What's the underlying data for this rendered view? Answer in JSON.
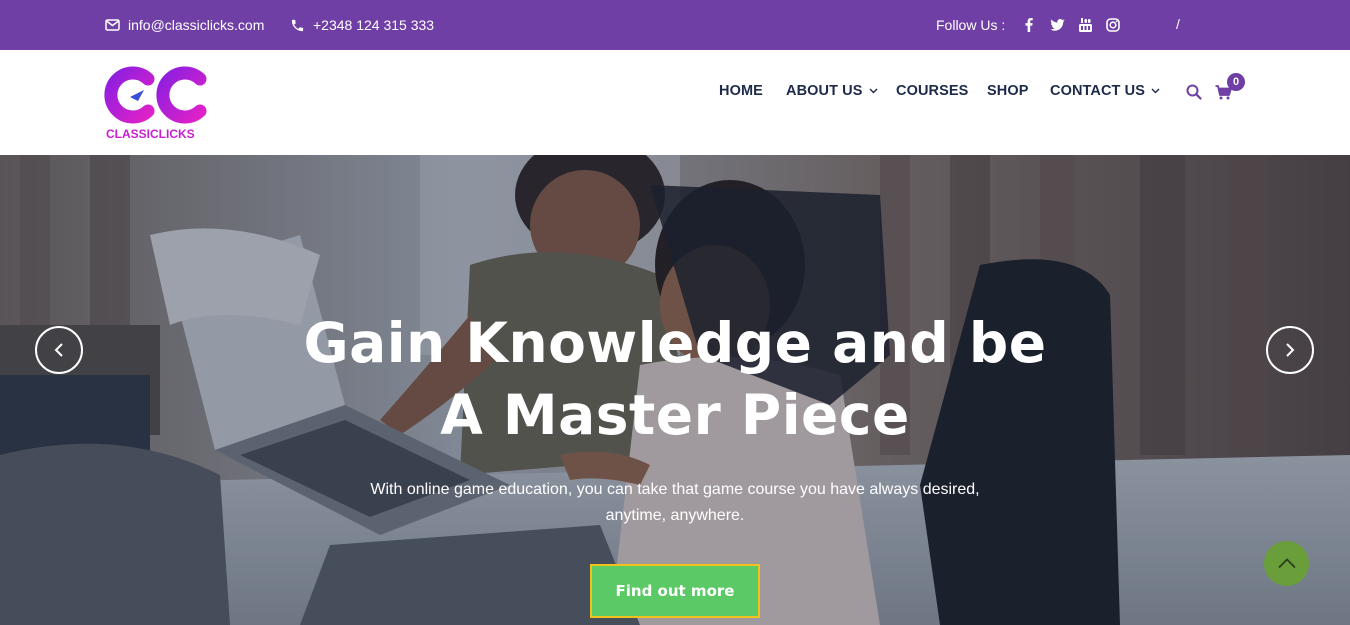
{
  "topbar": {
    "email": "info@classiclicks.com",
    "phone": "+2348 124 315 333",
    "follow_label": "Follow Us :",
    "social_icons": [
      "facebook-icon",
      "twitter-icon",
      "youtube-icon",
      "instagram-icon"
    ],
    "separator": "/"
  },
  "header": {
    "logo_text": "CLASSICLICKS",
    "nav": {
      "home": "HOME",
      "about": "ABOUT US",
      "courses": "COURSES",
      "shop": "SHOP",
      "contact": "CONTACT US"
    },
    "cart_count": "0"
  },
  "hero": {
    "title_line1": "Gain Knowledge and be",
    "title_line2": "A Master Piece",
    "subtitle_line1": "With online game education, you can take that game course you have always desired,",
    "subtitle_line2": "anytime, anywhere.",
    "cta_label": "Find out more"
  },
  "colors": {
    "topbar_bg": "#6f3fa5",
    "nav_text": "#1d2a4a",
    "brand_magenta": "#c81fcf",
    "cta_bg": "#5cc967",
    "cta_border": "#f0c21b",
    "scroll_top_bg": "#6a9e3a"
  }
}
